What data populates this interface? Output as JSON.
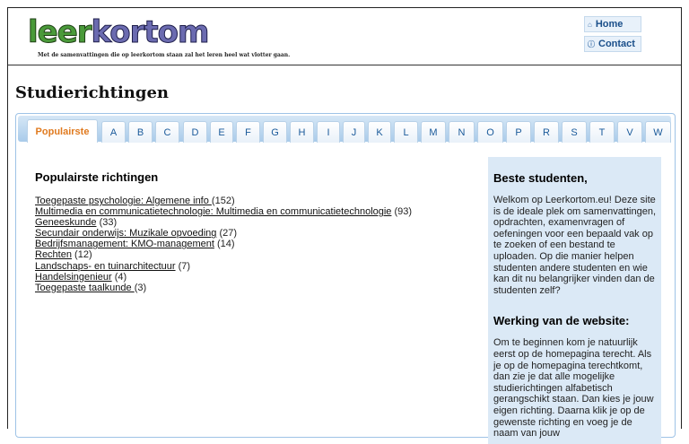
{
  "header": {
    "logo_part1": "leer",
    "logo_part2": "kortom",
    "tagline": "Met de samenvattingen die op leerkortom staan zal het leren heel wat vlotter gaan.",
    "nav": [
      {
        "label": "Home",
        "icon": "home-icon"
      },
      {
        "label": "Contact",
        "icon": "info-icon"
      }
    ]
  },
  "page": {
    "title": "Studierichtingen"
  },
  "tabs": [
    "Populairste",
    "A",
    "B",
    "C",
    "D",
    "E",
    "F",
    "G",
    "H",
    "I",
    "J",
    "K",
    "L",
    "M",
    "N",
    "O",
    "P",
    "R",
    "S",
    "T",
    "V",
    "W"
  ],
  "popular": {
    "title": "Populairste richtingen",
    "items": [
      {
        "name": "Toegepaste psychologie: Algemene info ",
        "count": "(152)"
      },
      {
        "name": "Multimedia en communicatietechnologie: Multimedia en communicatietechnologie",
        "count": "(93)"
      },
      {
        "name": "Geneeskunde",
        "count": "(33)"
      },
      {
        "name": "Secundair onderwijs: Muzikale opvoeding",
        "count": "(27)"
      },
      {
        "name": "Bedrijfsmanagement: KMO-management",
        "count": "(14)"
      },
      {
        "name": "Rechten",
        "count": "(12)"
      },
      {
        "name": "Landschaps- en tuinarchitectuur",
        "count": "(7)"
      },
      {
        "name": "Handelsingenieur",
        "count": "(4)"
      },
      {
        "name": "Toegepaste taalkunde ",
        "count": "(3)"
      }
    ]
  },
  "sidebar": {
    "welcome_title": "Beste studenten,",
    "welcome_text": "Welkom op Leerkortom.eu! Deze site is de ideale plek om samenvattingen, opdrachten, examenvragen of oefeningen voor een bepaald vak op te zoeken of een bestand te uploaden. Op die manier helpen studenten andere studenten en wie kan dit nu belangrijker vinden dan de studenten zelf?",
    "how_title": "Werking van de website:",
    "how_text": "Om te beginnen kom je natuurlijk eerst op de homepagina terecht. Als je op de homepagina terechtkomt, dan zie je dat alle mogelijke studierichtingen alfabetisch gerangschikt staan. Dan kies je jouw eigen richting. Daarna klik je op de gewenste richting en voeg je de naam van jouw"
  }
}
